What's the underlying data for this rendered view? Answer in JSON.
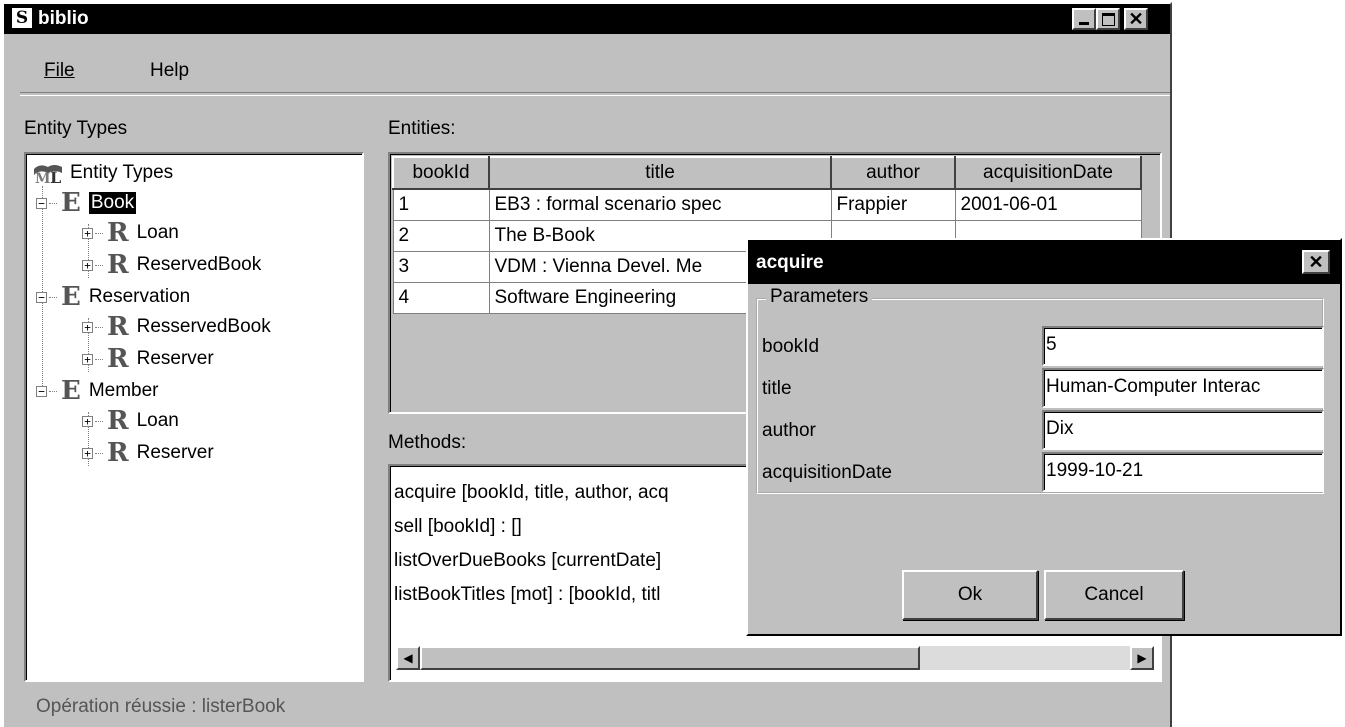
{
  "window": {
    "title": "biblio",
    "app_icon": "S"
  },
  "menu": {
    "file": "File",
    "help": "Help"
  },
  "left": {
    "label": "Entity Types",
    "tree_root": "Entity Types",
    "tree": [
      {
        "icon": "E",
        "label": "Book",
        "selected": true
      },
      {
        "icon": "R",
        "label": "Loan"
      },
      {
        "icon": "R",
        "label": "ReservedBook"
      },
      {
        "icon": "E",
        "label": "Reservation"
      },
      {
        "icon": "R",
        "label": "ResservedBook"
      },
      {
        "icon": "R",
        "label": "Reserver"
      },
      {
        "icon": "E",
        "label": "Member"
      },
      {
        "icon": "R",
        "label": "Loan"
      },
      {
        "icon": "R",
        "label": "Reserver"
      }
    ]
  },
  "entities": {
    "label": "Entities:",
    "columns": [
      "bookId",
      "title",
      "author",
      "acquisitionDate"
    ],
    "rows": [
      [
        "1",
        "EB3 : formal scenario spec",
        "Frappier",
        "2001-06-01"
      ],
      [
        "2",
        "The B-Book",
        "",
        ""
      ],
      [
        "3",
        "VDM : Vienna Devel. Me",
        "",
        ""
      ],
      [
        "4",
        "Software Engineering",
        "",
        ""
      ]
    ]
  },
  "methods": {
    "label": "Methods:",
    "items": [
      "acquire  [bookId, title, author, acq",
      "sell  [bookId] : []",
      "listOverDueBooks  [currentDate]",
      "listBookTitles  [mot] : [bookId, titl"
    ]
  },
  "status": "Opération réussie : listerBook",
  "dialog": {
    "title": "acquire",
    "group_label": "Parameters",
    "params": [
      {
        "label": "bookId",
        "value": "5"
      },
      {
        "label": "title",
        "value": "Human-Computer Interac"
      },
      {
        "label": "author",
        "value": "Dix"
      },
      {
        "label": "acquisitionDate",
        "value": "1999-10-21"
      }
    ],
    "ok": "Ok",
    "cancel": "Cancel"
  }
}
